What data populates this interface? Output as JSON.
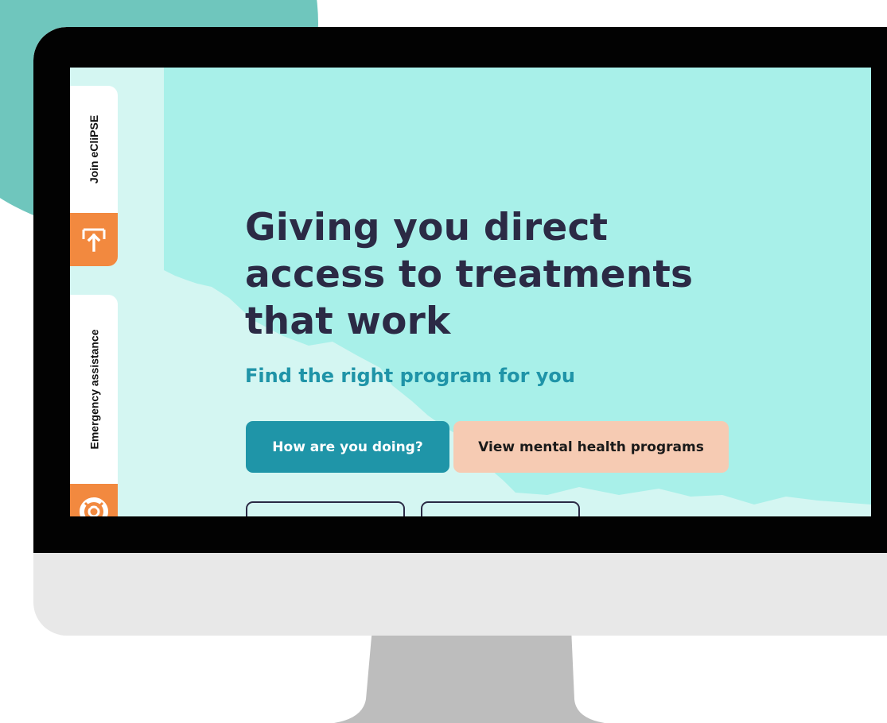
{
  "sidebar": {
    "join_label": "Join eCliPSE",
    "join_icon": "arrow-up-box-icon",
    "emergency_label": "Emergency assistance",
    "emergency_icon": "lifebuoy-icon"
  },
  "hero": {
    "title": "Giving you direct access to treatments that work",
    "subtitle": "Find the right program for you",
    "primary_button": "How are you doing?",
    "secondary_button": "View mental health programs"
  },
  "colors": {
    "background_teal": "#a8f0e9",
    "accent_orange": "#f2893f",
    "primary_button": "#1f95a8",
    "secondary_button": "#f6cbb3",
    "title_text": "#2b2a45",
    "subtitle_text": "#1f94a8",
    "decor_circle": "#6fc6bd"
  }
}
